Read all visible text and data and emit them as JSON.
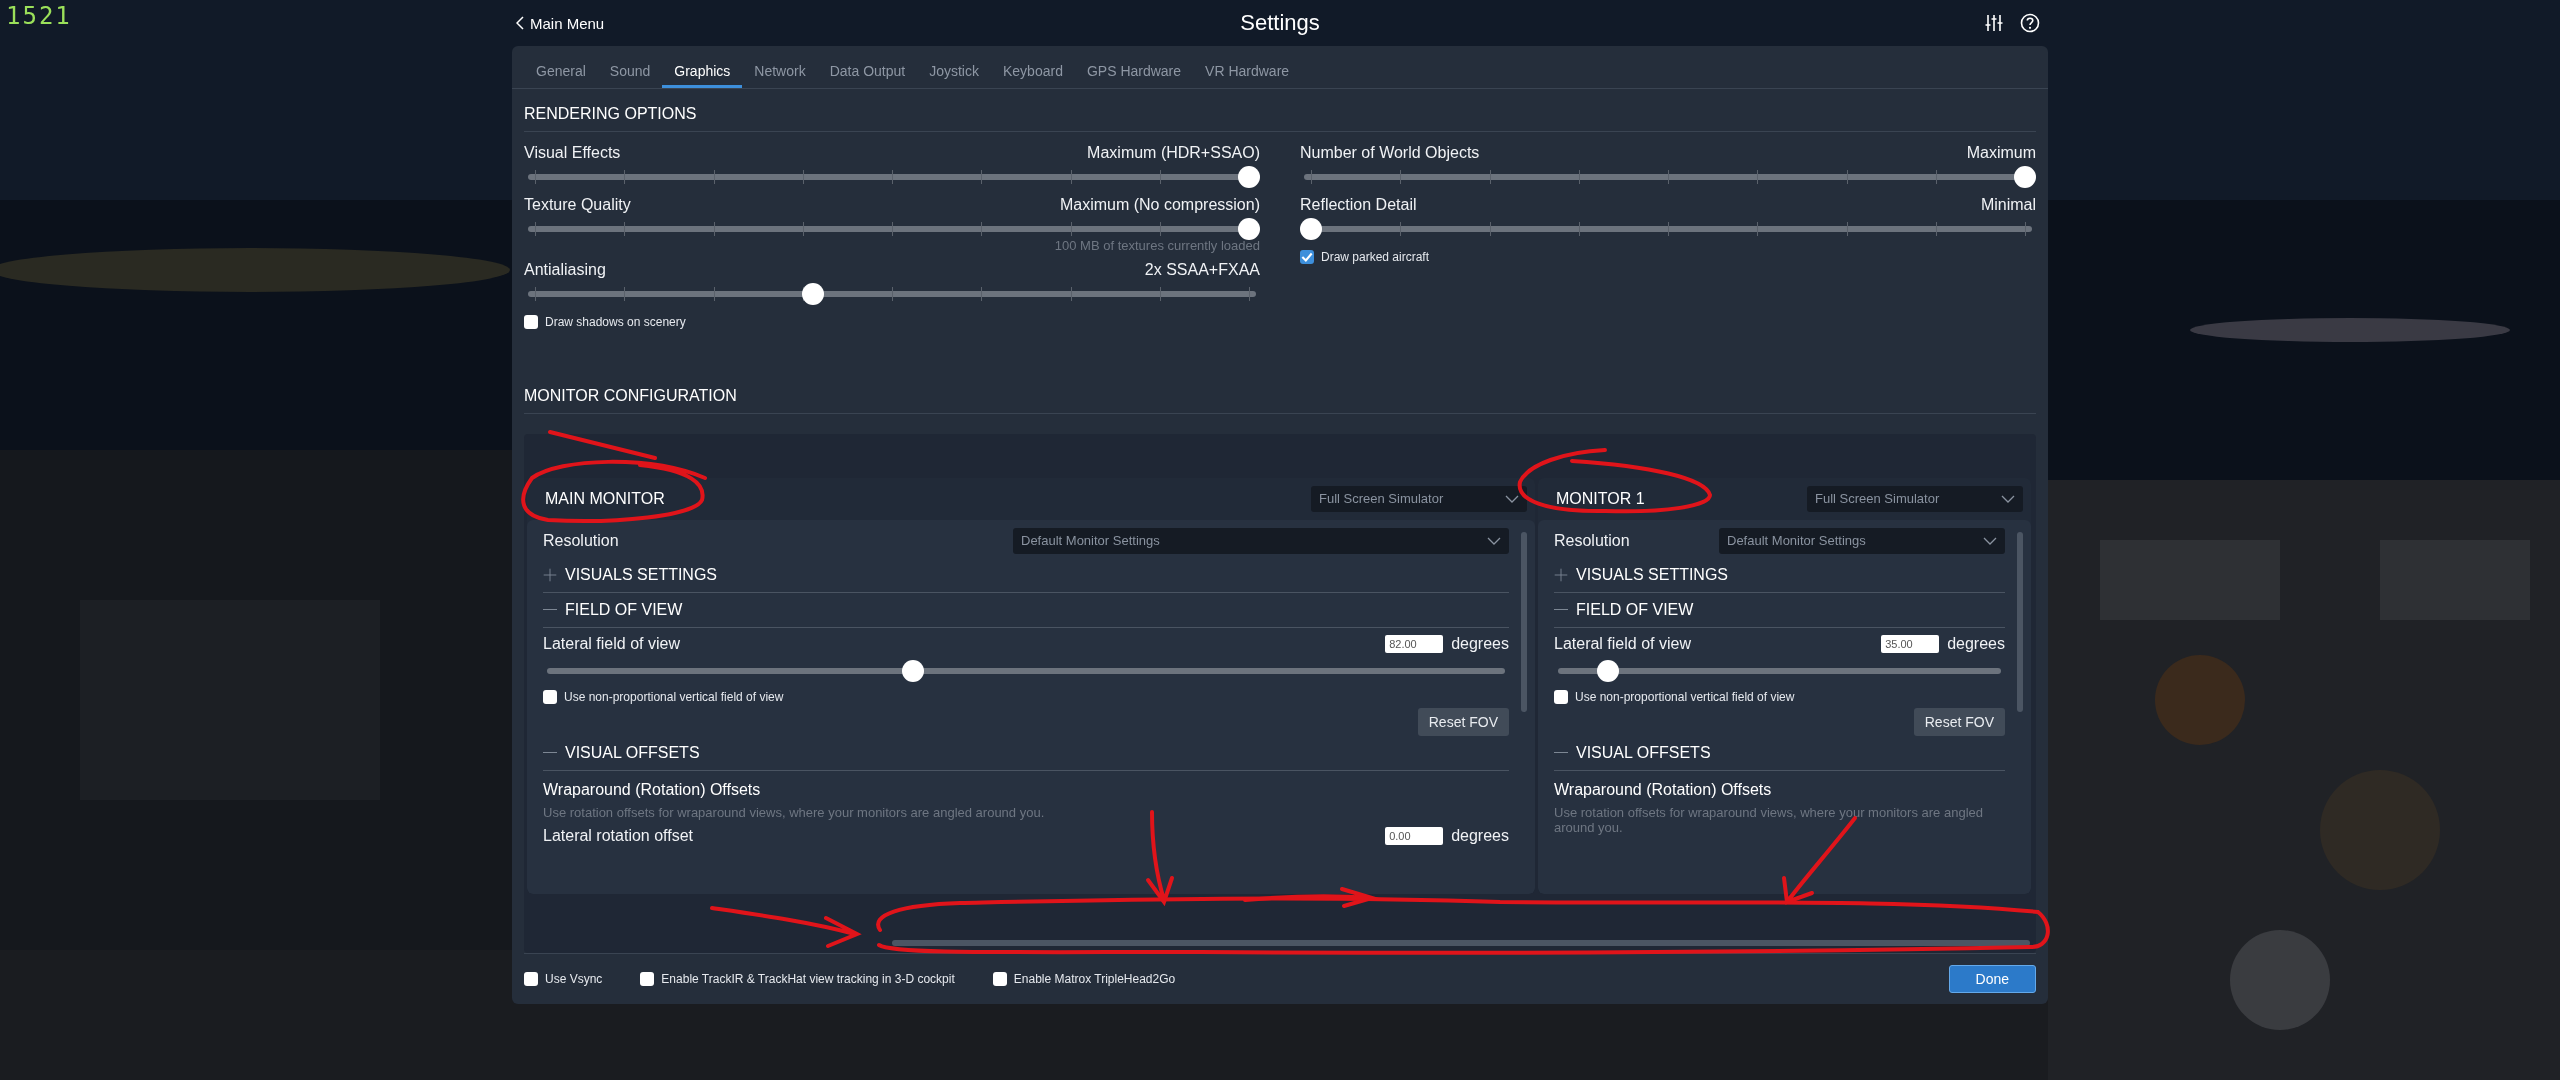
{
  "frame_counter": "1521",
  "header": {
    "back": "Main Menu",
    "title": "Settings"
  },
  "tabs": [
    {
      "label": "General",
      "selected": false
    },
    {
      "label": "Sound",
      "selected": false
    },
    {
      "label": "Graphics",
      "selected": true
    },
    {
      "label": "Network",
      "selected": false
    },
    {
      "label": "Data Output",
      "selected": false
    },
    {
      "label": "Joystick",
      "selected": false
    },
    {
      "label": "Keyboard",
      "selected": false
    },
    {
      "label": "GPS Hardware",
      "selected": false
    },
    {
      "label": "VR Hardware",
      "selected": false
    }
  ],
  "rendering": {
    "heading": "RENDERING OPTIONS",
    "left": [
      {
        "kind": "slider",
        "label": "Visual Effects",
        "reading": "Maximum (HDR+SSAO)",
        "level": 1
      },
      {
        "kind": "slider",
        "label": "Texture Quality",
        "reading": "Maximum (No compression)",
        "level": 1,
        "note": "100 MB of textures currently loaded"
      },
      {
        "kind": "slider",
        "label": "Antialiasing",
        "reading": "2x SSAA+FXAA",
        "level": 0.39
      },
      {
        "kind": "checkbox",
        "label": "Draw shadows on scenery",
        "checked": false
      }
    ],
    "right": [
      {
        "kind": "slider",
        "label": "Number of World Objects",
        "reading": "Maximum",
        "level": 1
      },
      {
        "kind": "slider",
        "label": "Reflection Detail",
        "reading": "Minimal",
        "level": 0
      },
      {
        "kind": "checkbox",
        "label": "Draw parked aircraft",
        "checked": true
      }
    ]
  },
  "monitors": {
    "heading": "MONITOR CONFIGURATION",
    "cards": [
      {
        "title": "MAIN MONITOR",
        "mode": "Full Screen Simulator",
        "resolution_label": "Resolution",
        "resolution": "Default Monitor Settings",
        "visuals": {
          "label": "VISUALS SETTINGS",
          "expanded": false
        },
        "fov": {
          "label": "FIELD OF VIEW",
          "expanded": true
        },
        "fov_label": "Lateral field of view",
        "fov_value": "82.00",
        "fov_unit": "degrees",
        "level": 0.38,
        "nonprop": {
          "label": "Use non-proportional vertical field of view",
          "checked": false
        },
        "reset": "Reset FOV",
        "offsets": {
          "label": "VISUAL OFFSETS",
          "expanded": true
        },
        "wrap_title": "Wraparound (Rotation) Offsets",
        "wrap_desc": "Use rotation offsets for wraparound views, where your monitors are angled around you.",
        "rotation": {
          "label": "Lateral rotation offset",
          "value": "0.00",
          "unit": "degrees"
        }
      },
      {
        "title": "MONITOR 1",
        "mode": "Full Screen Simulator",
        "resolution_label": "Resolution",
        "resolution": "Default Monitor Settings",
        "visuals": {
          "label": "VISUALS SETTINGS",
          "expanded": false
        },
        "fov": {
          "label": "FIELD OF VIEW",
          "expanded": true
        },
        "fov_label": "Lateral field of view",
        "fov_value": "35.00",
        "fov_unit": "degrees",
        "level": 0.1,
        "nonprop": {
          "label": "Use non-proportional vertical field of view",
          "checked": false
        },
        "reset": "Reset FOV",
        "offsets": {
          "label": "VISUAL OFFSETS",
          "expanded": true
        },
        "wrap_title": "Wraparound (Rotation) Offsets",
        "wrap_desc": "Use rotation offsets for wraparound views, where your monitors are angled around you."
      }
    ]
  },
  "footer": {
    "options": [
      {
        "label": "Use Vsync",
        "checked": false
      },
      {
        "label": "Enable TrackIR & TrackHat view tracking in 3-D cockpit",
        "checked": false
      },
      {
        "label": "Enable Matrox TripleHead2Go",
        "checked": false
      }
    ],
    "done": "Done"
  }
}
